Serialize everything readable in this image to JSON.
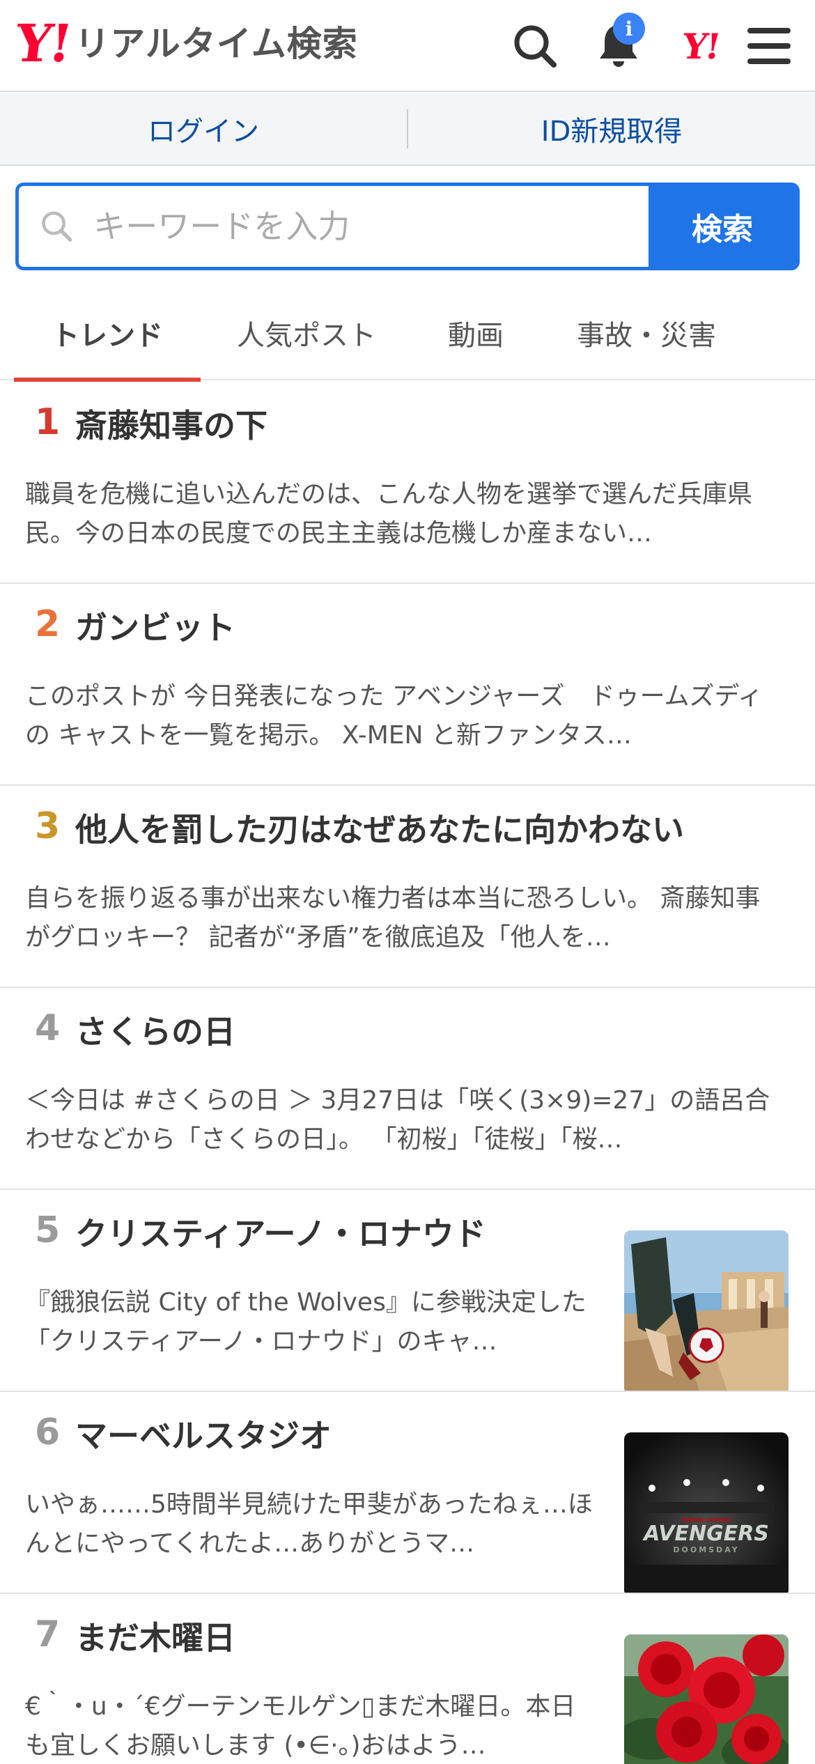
{
  "header": {
    "logo_mark": "Y!",
    "logo_text": "リアルタイム検索",
    "notification_badge": "i",
    "yahoo_mark": "Y!"
  },
  "auth": {
    "login": "ログイン",
    "register": "ID新規取得"
  },
  "search": {
    "placeholder": "キーワードを入力",
    "button": "検索"
  },
  "tabs": [
    "トレンド",
    "人気ポスト",
    "動画",
    "事故・災害"
  ],
  "colors": {
    "accent_blue": "#1f75e8",
    "brand_red": "#ff0033",
    "tab_underline": "#e0443a",
    "rank1": "#d63a2f",
    "rank2": "#e8733a",
    "rank3": "#c8962a",
    "rank_other": "#9a9a9a"
  },
  "trends": [
    {
      "rank": "1",
      "title": "斎藤知事の下",
      "desc": "職員を危機に追い込んだのは、こんな人物を選挙で選んだ兵庫県民。今の日本の民度での民主主義は危機しか産まない…",
      "thumb": null
    },
    {
      "rank": "2",
      "title": "ガンビット",
      "desc": "このポストが 今日発表になった アベンジャーズ　ドゥームズディの キャストを一覧を掲示。 X-MEN と新ファンタス…",
      "thumb": null
    },
    {
      "rank": "3",
      "title": "他人を罰した刃はなぜあなたに向かわない",
      "desc": "自らを振り返る事が出来ない権力者は本当に恐ろしい。 斎藤知事がグロッキー？ 記者が“矛盾”を徹底追及「他人を…",
      "thumb": null
    },
    {
      "rank": "4",
      "title": "さくらの日",
      "desc": "＜今日は #さくらの日 ＞ 3月27日は「咲く(3×9)=27」の語呂合わせなどから「さくらの日」。 「初桜」「徒桜」「桜…",
      "thumb": null
    },
    {
      "rank": "5",
      "title": "クリスティアーノ・ロナウド",
      "desc": "『餓狼伝説 City of the Wolves』に参戦決定した「クリスティアーノ・ロナウド」のキャ…",
      "thumb": "soccer-game-image"
    },
    {
      "rank": "6",
      "title": "マーベルスタジオ",
      "desc": "いやぁ……5時間半見続けた甲斐があったねぇ…ほんとにやってくれたよ…ありがとうマ…",
      "thumb": "avengers-logo-image"
    },
    {
      "rank": "7",
      "title": "まだ木曜日",
      "desc": "€｀・u・´€グーテンモルゲン▯まだ木曜日。本日も宜しくお願いします (•∈·。)おはよう…",
      "thumb": "red-roses-image"
    }
  ],
  "thumb_texts": {
    "avengers_small": "MARVEL STUDIOS",
    "avengers_title": "AVENGERS",
    "avengers_sub": "DOOMSDAY"
  }
}
